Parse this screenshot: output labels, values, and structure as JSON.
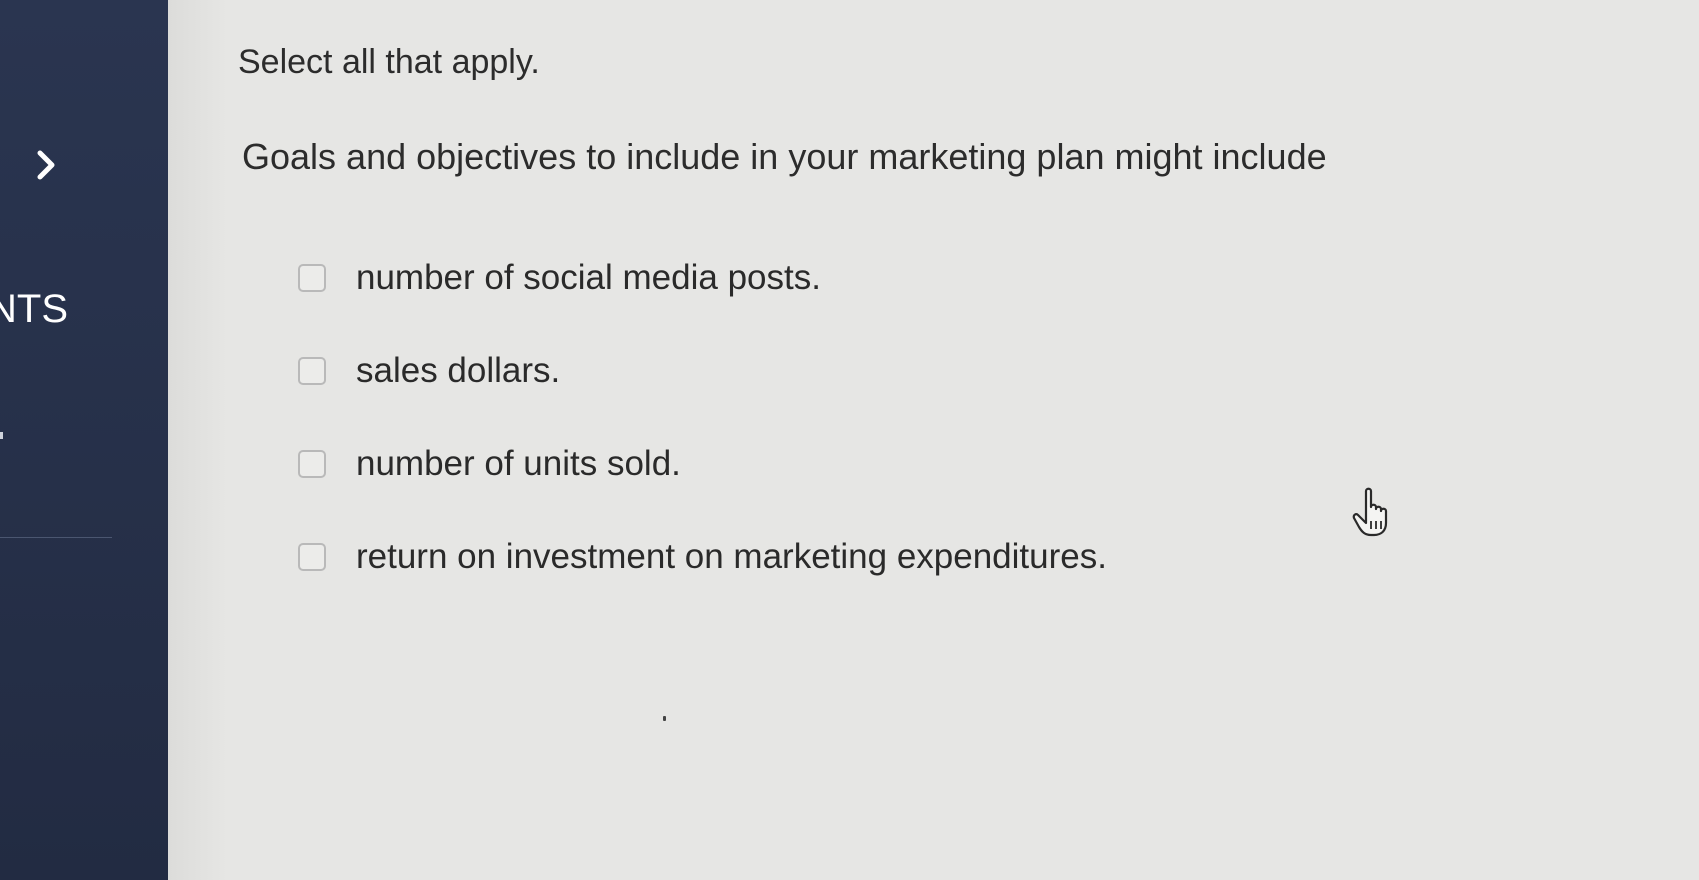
{
  "sidebar": {
    "toggle_icon": "chevron-right-icon",
    "section_label": "NTS"
  },
  "question": {
    "instruction": "Select all that apply.",
    "prompt": "Goals and objectives to include in your marketing plan might include",
    "options": [
      {
        "label": "number of social media posts.",
        "checked": false
      },
      {
        "label": "sales dollars.",
        "checked": false
      },
      {
        "label": "number of units sold.",
        "checked": false
      },
      {
        "label": "return on investment on marketing expenditures.",
        "checked": false
      }
    ]
  },
  "cursor": {
    "icon": "hand-pointer-cursor-icon"
  },
  "colors": {
    "sidebar": "#263049",
    "background": "#e6e6e4",
    "text": "#2c2c2c",
    "checkbox_border": "#b9b9b9"
  }
}
